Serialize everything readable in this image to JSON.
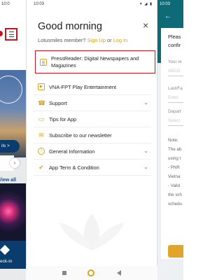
{
  "left_panel": {
    "status_time": "10:0",
    "pill_label": "ils >",
    "view_all": "/iew all",
    "check_in": "eck-in"
  },
  "drawer": {
    "status_time": "10:03",
    "status_icons": "▾ ◢ ▮",
    "greeting": "Good morning",
    "close_icon": "×",
    "member_prefix": "Lotusmiles member?",
    "sign_up": "Sign Up",
    "or": "or",
    "log_in": "Log In",
    "items": [
      {
        "label": "PressReader: Digital Newspapers and Magazines",
        "icon": "newspaper-icon",
        "glyph": "",
        "chevron": ""
      },
      {
        "label": "VNA-FPT Play Entertainment",
        "icon": "play-icon",
        "glyph": "▶",
        "chevron": ""
      },
      {
        "label": "Support",
        "icon": "support-icon",
        "glyph": "☎",
        "chevron": "⌄"
      },
      {
        "label": "Tips for App",
        "icon": "tips-icon",
        "glyph": "▭",
        "chevron": ""
      },
      {
        "label": "Subscribe to our newsletter",
        "icon": "mail-icon",
        "glyph": "✉",
        "chevron": ""
      },
      {
        "label": "General Information",
        "icon": "info-icon",
        "glyph": "i",
        "chevron": "⌄"
      },
      {
        "label": "App Term & Condition",
        "icon": "shield-icon",
        "glyph": "✔",
        "chevron": "⌄"
      }
    ]
  },
  "right_panel": {
    "status_time": "10:03",
    "back_icon": "←",
    "title_line1": "Pleas",
    "title_line2": "confir",
    "field1_label": "Your re",
    "field1_value": "ABCD",
    "field2_label": "Last/Fa",
    "field2_value": "Enter",
    "field3_label": "Depart",
    "field3_value": "Select",
    "note_label": "Note:",
    "note_lines": [
      "The ab",
      "using t",
      "- PNR",
      "Vietna",
      "- Valid",
      "the sch",
      "schedu"
    ]
  },
  "colors": {
    "brand_gold": "#d8a21a",
    "highlight_red": "#c4161c",
    "brand_navy": "#0b3c6e",
    "brand_teal": "#0d6b78"
  }
}
